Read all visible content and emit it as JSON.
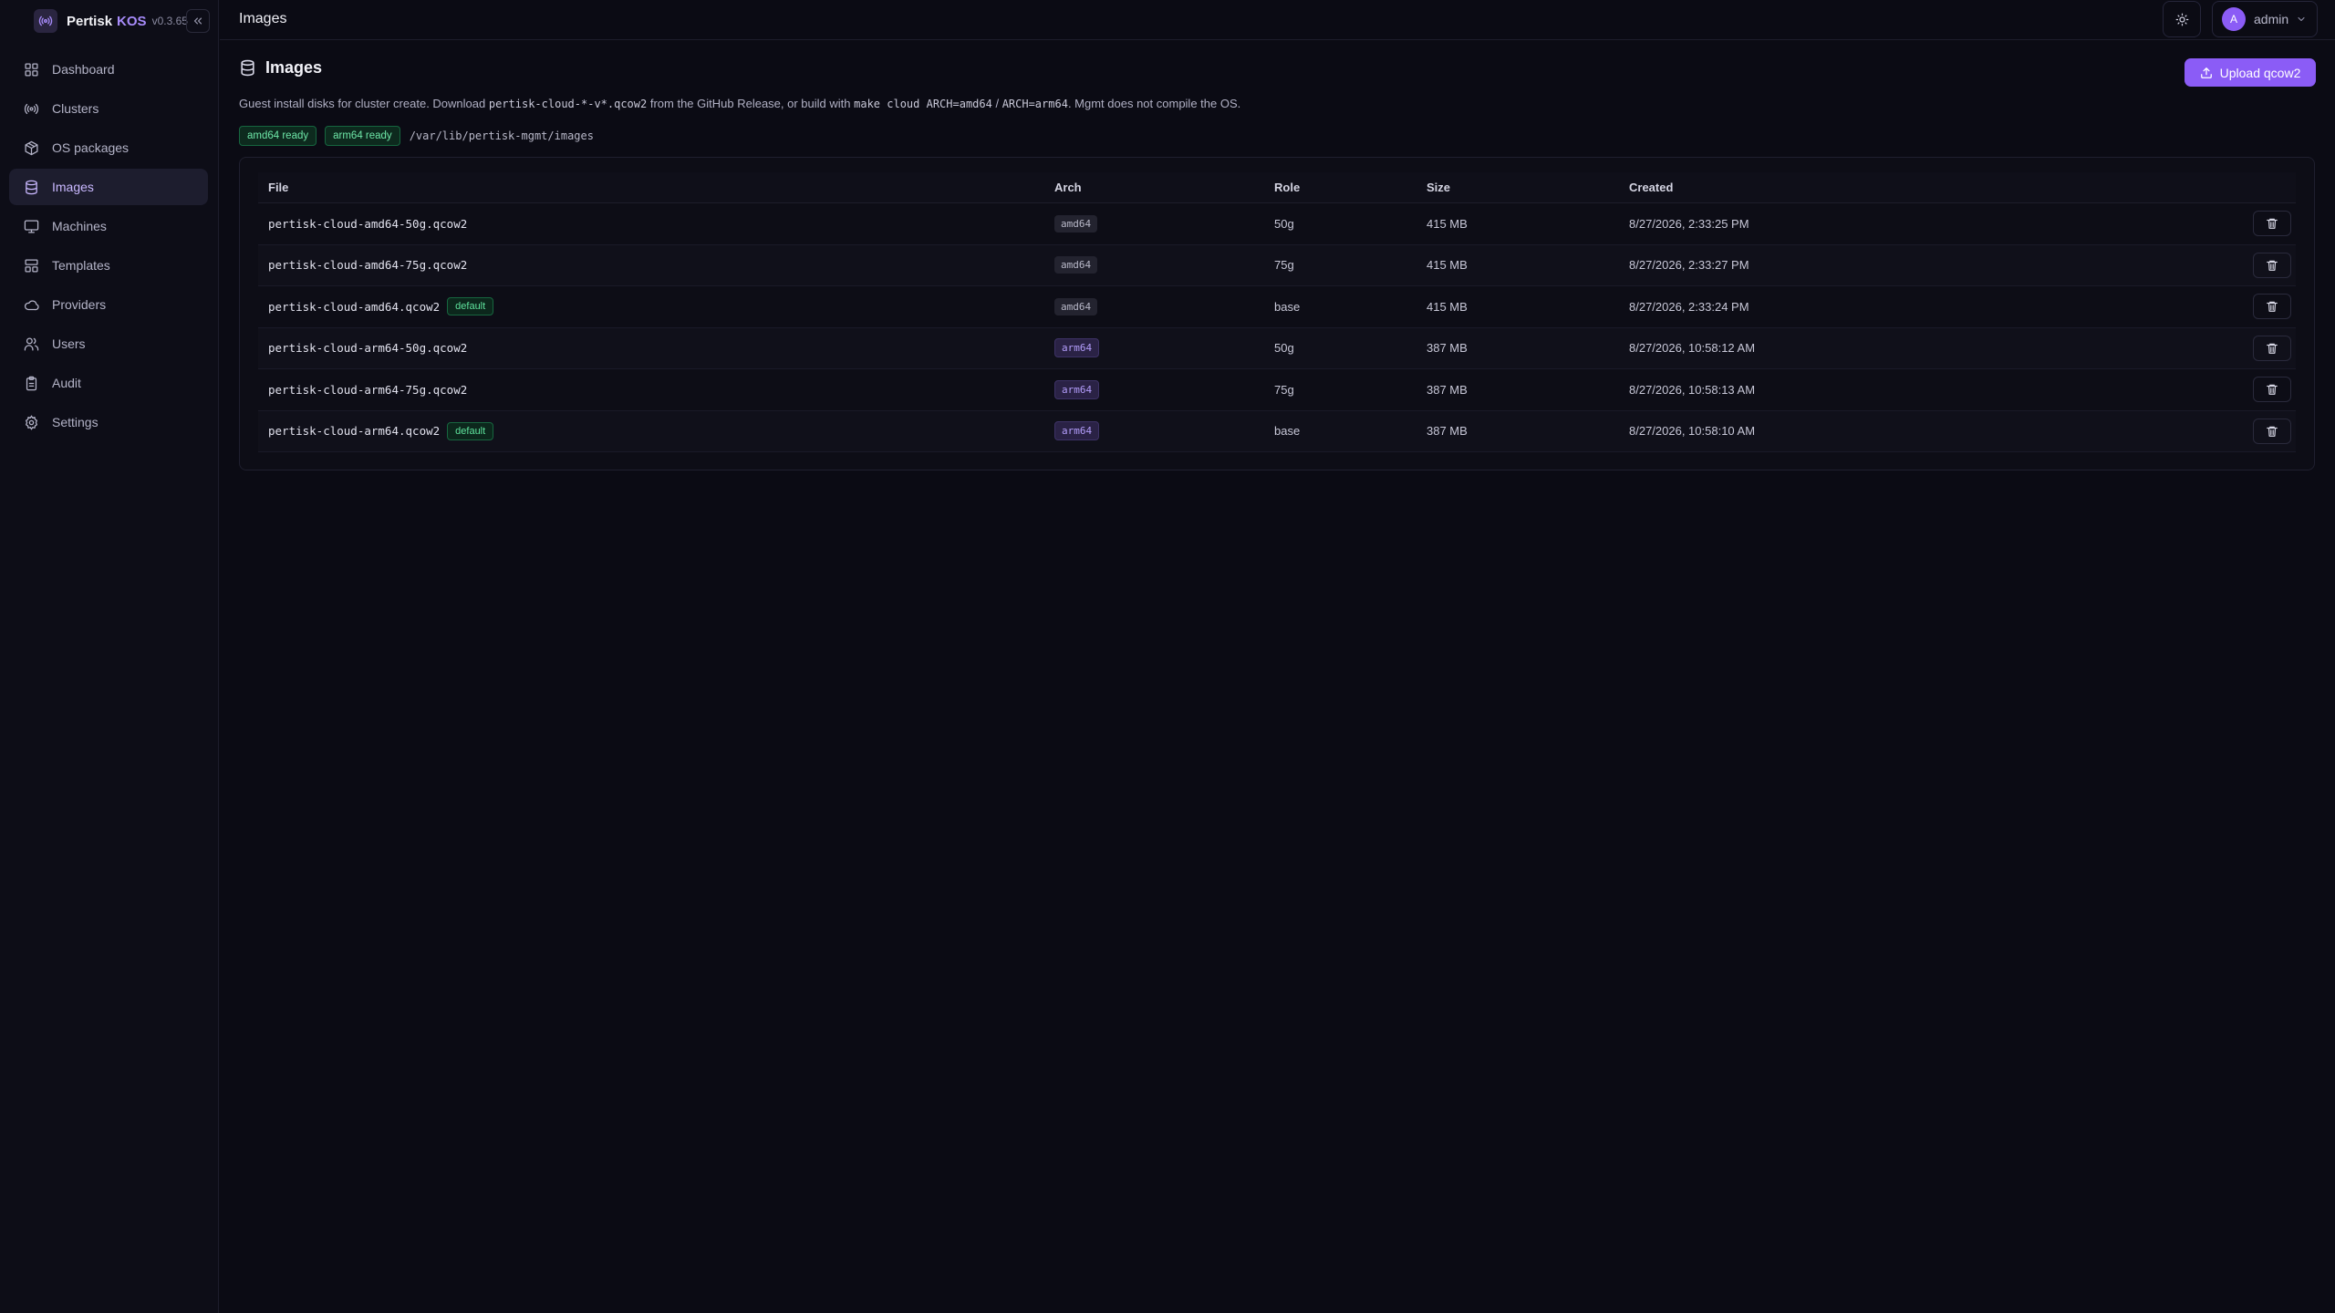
{
  "brand": {
    "name": "Pertisk",
    "product": "KOS",
    "version": "v0.3.65"
  },
  "sidebar": {
    "items": [
      {
        "label": "Dashboard",
        "icon": "dashboard-icon"
      },
      {
        "label": "Clusters",
        "icon": "radio-icon"
      },
      {
        "label": "OS packages",
        "icon": "package-icon"
      },
      {
        "label": "Images",
        "icon": "database-icon",
        "active": true
      },
      {
        "label": "Machines",
        "icon": "monitor-icon"
      },
      {
        "label": "Templates",
        "icon": "layout-icon"
      },
      {
        "label": "Providers",
        "icon": "cloud-icon"
      },
      {
        "label": "Users",
        "icon": "users-icon"
      },
      {
        "label": "Audit",
        "icon": "clipboard-icon"
      },
      {
        "label": "Settings",
        "icon": "gear-icon"
      }
    ]
  },
  "header": {
    "title": "Images",
    "user": {
      "initial": "A",
      "name": "admin"
    }
  },
  "main": {
    "title": "Images",
    "upload_label": "Upload qcow2",
    "description": {
      "part1": "Guest install disks for cluster create. Download ",
      "code1": "pertisk-cloud-*-v*.qcow2",
      "part2": " from the GitHub Release, or build with ",
      "code2": "make cloud ARCH=amd64",
      "part3": " / ",
      "code3": "ARCH=arm64",
      "part4": ". Mgmt does not compile the OS."
    },
    "badges": [
      "amd64 ready",
      "arm64 ready"
    ],
    "path": "/var/lib/pertisk-mgmt/images"
  },
  "table": {
    "columns": [
      "File",
      "Arch",
      "Role",
      "Size",
      "Created"
    ],
    "default_label": "default",
    "rows": [
      {
        "file": "pertisk-cloud-amd64-50g.qcow2",
        "arch": "amd64",
        "role": "50g",
        "size": "415 MB",
        "created": "8/27/2026, 2:33:25 PM",
        "is_default": false
      },
      {
        "file": "pertisk-cloud-amd64-75g.qcow2",
        "arch": "amd64",
        "role": "75g",
        "size": "415 MB",
        "created": "8/27/2026, 2:33:27 PM",
        "is_default": false
      },
      {
        "file": "pertisk-cloud-amd64.qcow2",
        "arch": "amd64",
        "role": "base",
        "size": "415 MB",
        "created": "8/27/2026, 2:33:24 PM",
        "is_default": true
      },
      {
        "file": "pertisk-cloud-arm64-50g.qcow2",
        "arch": "arm64",
        "role": "50g",
        "size": "387 MB",
        "created": "8/27/2026, 10:58:12 AM",
        "is_default": false
      },
      {
        "file": "pertisk-cloud-arm64-75g.qcow2",
        "arch": "arm64",
        "role": "75g",
        "size": "387 MB",
        "created": "8/27/2026, 10:58:13 AM",
        "is_default": false
      },
      {
        "file": "pertisk-cloud-arm64.qcow2",
        "arch": "arm64",
        "role": "base",
        "size": "387 MB",
        "created": "8/27/2026, 10:58:10 AM",
        "is_default": true
      }
    ]
  },
  "colors": {
    "accent": "#8b5cf6",
    "background": "#0b0b14",
    "success": "#6ee7a8"
  }
}
